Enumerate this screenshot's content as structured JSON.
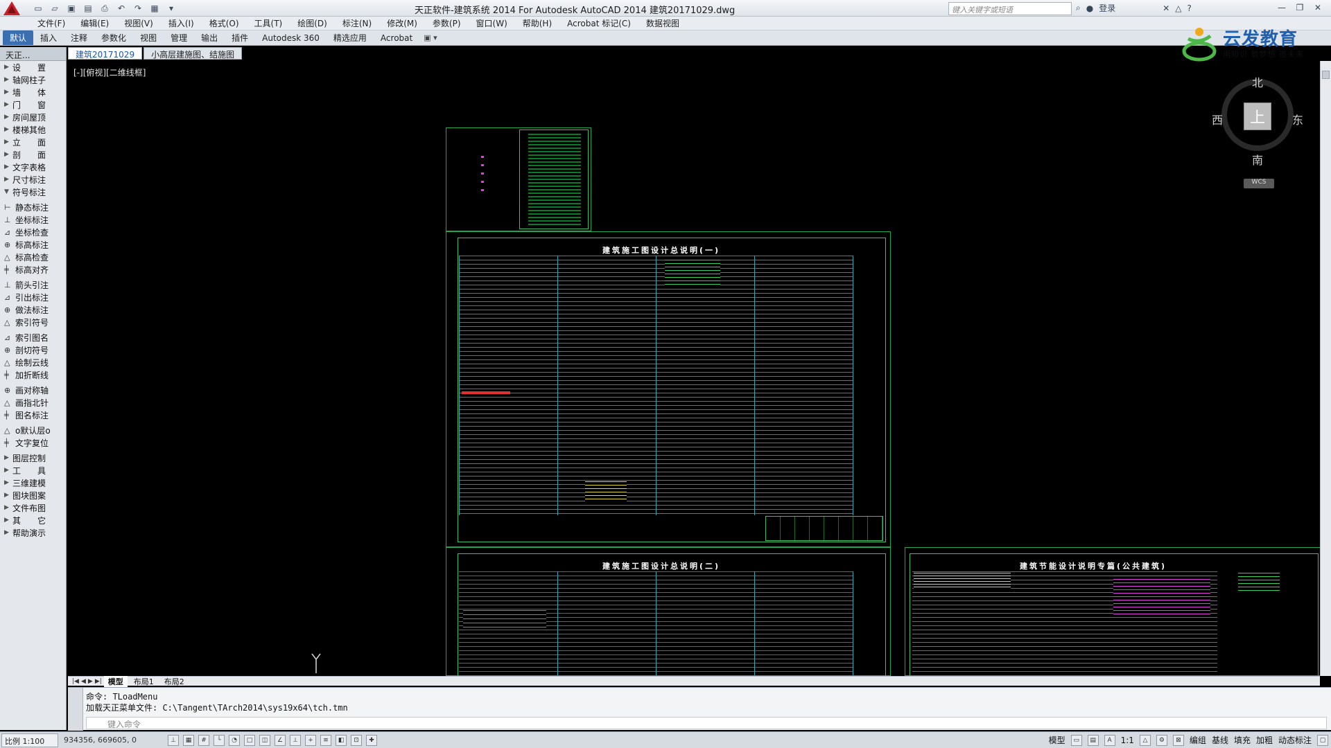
{
  "window": {
    "title": "天正软件-建筑系统 2014  For Autodesk AutoCAD 2014    建筑20171029.dwg",
    "search_placeholder": "键入关键字或短语",
    "login": "登录"
  },
  "menu": [
    "文件(F)",
    "编辑(E)",
    "视图(V)",
    "插入(I)",
    "格式(O)",
    "工具(T)",
    "绘图(D)",
    "标注(N)",
    "修改(M)",
    "参数(P)",
    "窗口(W)",
    "帮助(H)",
    "Acrobat 标记(C)",
    "数据视图"
  ],
  "ribbon_tabs": [
    "默认",
    "插入",
    "注释",
    "参数化",
    "视图",
    "管理",
    "输出",
    "插件",
    "Autodesk 360",
    "精选应用",
    "Acrobat"
  ],
  "brand": {
    "name": "云发教育",
    "slogan": "用知识 筑梦想 造未来"
  },
  "palette": {
    "header": "天正...",
    "groups": [
      [
        "设　　置",
        "轴网柱子",
        "墙　　体",
        "门　　窗",
        "房间屋顶",
        "楼梯其他",
        "立　　面",
        "剖　　面",
        "文字表格",
        "尺寸标注",
        "符号标注"
      ],
      [
        "静态标注",
        "坐标标注",
        "坐标检查",
        "标高标注",
        "标高检查",
        "标高对齐"
      ],
      [
        "箭头引注",
        "引出标注",
        "做法标注",
        "索引符号"
      ],
      [
        "索引图名",
        "剖切符号",
        "绘制云线",
        "加折断线"
      ],
      [
        "画对称轴",
        "画指北针",
        "图名标注"
      ],
      [
        "o默认层o",
        "文字复位"
      ],
      [
        "图层控制",
        "工　　具",
        "三维建模",
        "图块图案",
        "文件布图",
        "其　　它",
        "帮助演示"
      ]
    ]
  },
  "doc_tabs": [
    "建筑20171029",
    "小高层建施图、结施图"
  ],
  "view_label": "[-][俯视][二维线框]",
  "sheets": {
    "title1": "建筑施工图设计总说明(一)",
    "title2": "建筑施工图设计总说明(二)",
    "title3": "建筑节能设计说明专篇(公共建筑)"
  },
  "viewcube": {
    "north": "北",
    "south": "南",
    "east": "东",
    "west": "西",
    "face": "上",
    "wcs": "WCS"
  },
  "layout_tabs": [
    "模型",
    "布局1",
    "布局2"
  ],
  "command": {
    "line1": "命令: TLoadMenu",
    "line2": "加载天正菜单文件: C:\\Tangent\\TArch2014\\sys19x64\\tch.tmn",
    "placeholder": "键入命令"
  },
  "status": {
    "scale": "比例 1:100",
    "coords": "934356,  669605,  0",
    "right": [
      "模型",
      "1:1",
      "编组",
      "基线",
      "填充",
      "加粗",
      "动态标注"
    ]
  },
  "colors": {
    "accent": "#3c6fb0",
    "sheet_border": "#1fa84a",
    "column_line": "#2aa7b8"
  }
}
